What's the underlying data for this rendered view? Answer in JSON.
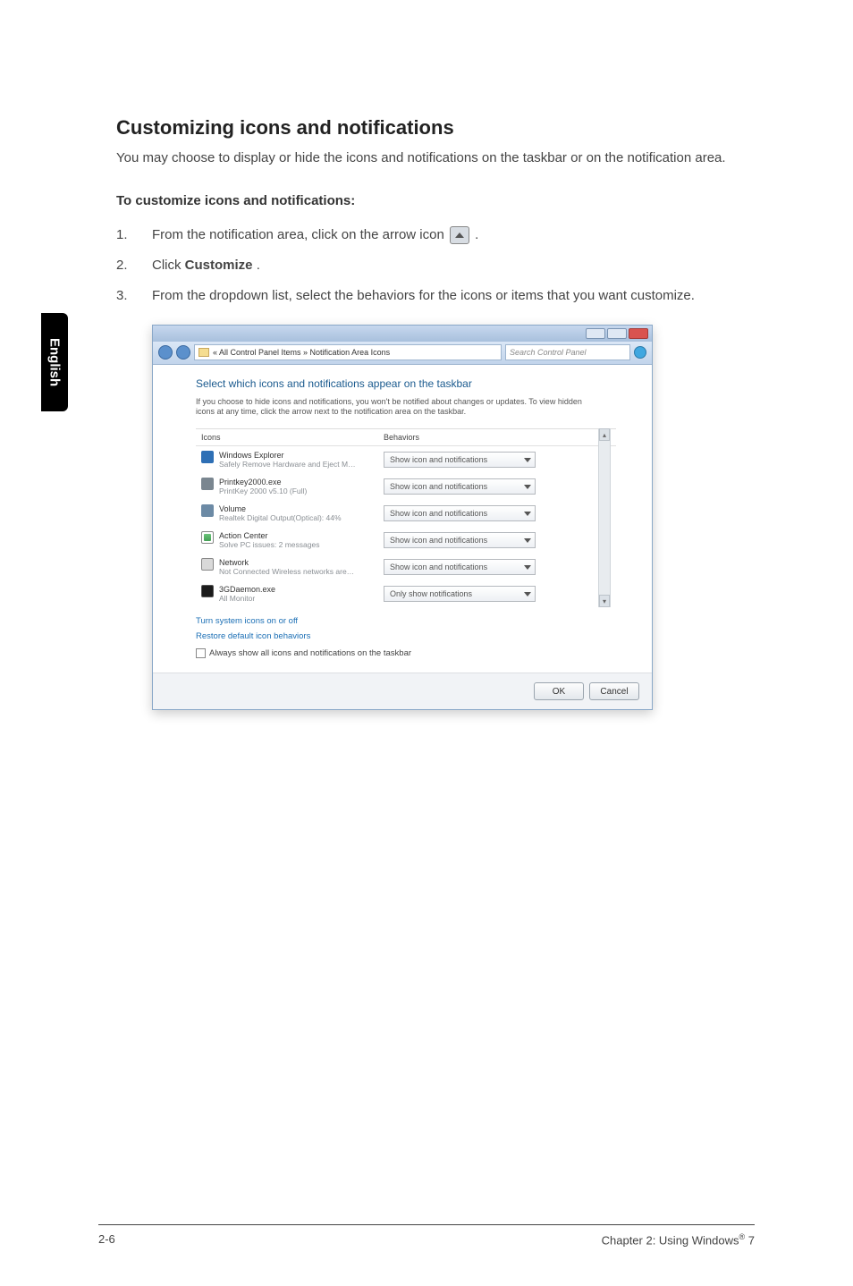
{
  "sidebar": {
    "language_tab": "English"
  },
  "section": {
    "title": "Customizing icons and notifications",
    "intro": "You may choose to display or hide the icons and notifications on the taskbar or on the notification area.",
    "subhead": "To customize icons and notifications:"
  },
  "steps": [
    {
      "num": "1.",
      "text_before": "From the notification area, click on the arrow icon ",
      "text_after": "."
    },
    {
      "num": "2.",
      "text_before": "Click ",
      "bold": "Customize",
      "text_after": "."
    },
    {
      "num": "3.",
      "text_before": "From the dropdown list, select the behaviors for the icons or items that you want customize.",
      "bold": "",
      "text_after": ""
    }
  ],
  "window": {
    "breadcrumb": "« All Control Panel Items » Notification Area Icons",
    "search_placeholder": "Search Control Panel",
    "heading": "Select which icons and notifications appear on the taskbar",
    "description": "If you choose to hide icons and notifications, you won't be notified about changes or updates. To view hidden icons at any time, click the arrow next to the notification area on the taskbar.",
    "col_icons": "Icons",
    "col_behaviors": "Behaviors",
    "rows": [
      {
        "title": "Windows Explorer",
        "sub": "Safely Remove Hardware and Eject M…",
        "behavior": "Show icon and notifications"
      },
      {
        "title": "Printkey2000.exe",
        "sub": "PrintKey 2000 v5.10 (Full)",
        "behavior": "Show icon and notifications"
      },
      {
        "title": "Volume",
        "sub": "Realtek Digital Output(Optical): 44%",
        "behavior": "Show icon and notifications"
      },
      {
        "title": "Action Center",
        "sub": "Solve PC issues: 2 messages",
        "behavior": "Show icon and notifications"
      },
      {
        "title": "Network",
        "sub": "Not Connected Wireless networks are…",
        "behavior": "Show icon and notifications"
      },
      {
        "title": "3GDaemon.exe",
        "sub": "All Monitor",
        "behavior": "Only show notifications"
      }
    ],
    "link_turn": "Turn system icons on or off",
    "link_restore": "Restore default icon behaviors",
    "checkbox_label": "Always show all icons and notifications on the taskbar",
    "btn_ok": "OK",
    "btn_cancel": "Cancel"
  },
  "footer": {
    "left": "2-6",
    "right_prefix": "Chapter 2: Using Windows",
    "right_suffix": " 7",
    "reg": "®"
  }
}
